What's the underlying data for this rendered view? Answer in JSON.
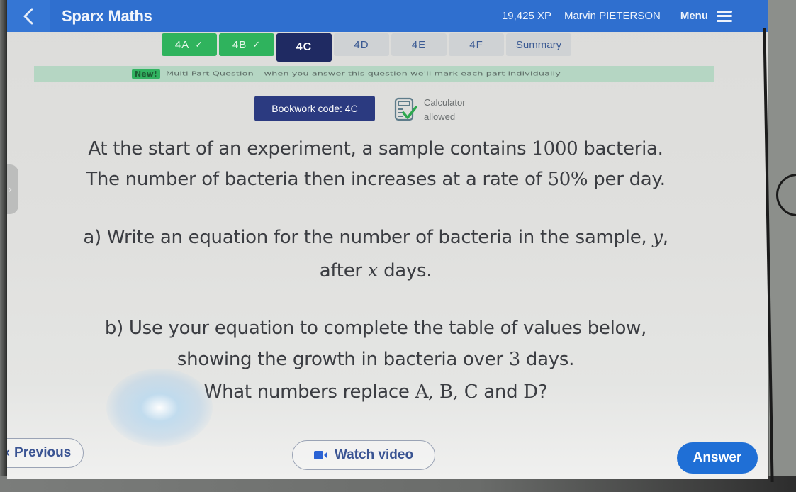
{
  "header": {
    "back_icon": "chevron-left-icon",
    "title": "Sparx Maths",
    "xp": "19,425 XP",
    "user_name": "Marvin PIETERSON",
    "menu_label": "Menu",
    "menu_icon": "hamburger-icon"
  },
  "tabs": [
    {
      "label": "4A",
      "status": "complete",
      "icon": "check-icon"
    },
    {
      "label": "4B",
      "status": "complete",
      "icon": "check-icon"
    },
    {
      "label": "4C",
      "status": "active"
    },
    {
      "label": "4D",
      "status": "pending"
    },
    {
      "label": "4E",
      "status": "pending"
    },
    {
      "label": "4F",
      "status": "pending"
    },
    {
      "label": "Summary",
      "status": "pending"
    }
  ],
  "notice": {
    "badge": "New!",
    "text": "Multi Part Question – when you answer this question we'll mark each part individually"
  },
  "bookwork": {
    "label": "Bookwork code: 4C"
  },
  "calculator": {
    "icon": "calculator-check-icon",
    "line1": "Calculator",
    "line2": "allowed"
  },
  "question": {
    "intro_1a": "At the start of an experiment, a sample contains ",
    "intro_1_num": "1000",
    "intro_1b": " bacteria.",
    "intro_2a": "The number of bacteria then increases at a rate of ",
    "intro_2_num": "50%",
    "intro_2b": " per day.",
    "part_a_1a": "a) Write an equation for the number of bacteria in the sample, ",
    "part_a_1_var": "y",
    "part_a_1b": ",",
    "part_a_2a": "after ",
    "part_a_2_var": "x",
    "part_a_2b": " days.",
    "part_b_1": "b) Use your equation to complete the table of values below,",
    "part_b_2a": "showing the growth in bacteria over ",
    "part_b_2_num": "3",
    "part_b_2b": " days.",
    "part_b_3a": "What numbers replace ",
    "part_b_3_letters": "A, B, C",
    "part_b_3_and": " and ",
    "part_b_3_d": "D",
    "part_b_3b": "?"
  },
  "footer": {
    "previous_label": "Previous",
    "previous_icon": "chevron-left-icon",
    "video_label": "Watch video",
    "video_icon": "video-camera-icon",
    "answer_label": "Answer"
  },
  "colors": {
    "header_blue": "#2f6fcf",
    "tab_complete": "#2fb35d",
    "tab_active": "#1f2a62",
    "bookwork_bg": "#2b3a80",
    "answer_btn": "#1f6fd6",
    "notice_bg": "#b5d6c3"
  }
}
